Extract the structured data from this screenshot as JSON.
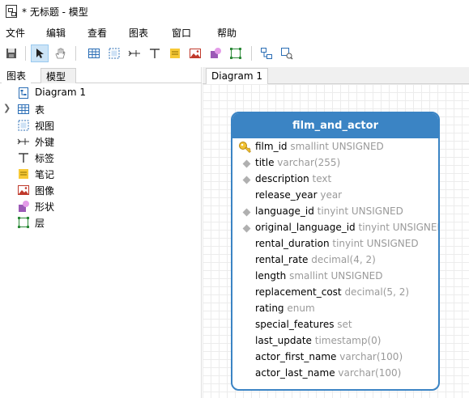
{
  "window": {
    "title": "* 无标题 - 模型"
  },
  "menu": [
    "文件",
    "编辑",
    "查看",
    "图表",
    "窗口",
    "帮助"
  ],
  "toolbar": {
    "tools": [
      "save-icon",
      "pointer-icon",
      "hand-icon",
      "table-icon",
      "view-icon",
      "foreign-key-icon",
      "label-icon",
      "note-icon",
      "image-icon",
      "shape-icon",
      "layer-icon",
      "auto-layout-icon",
      "zoom-fit-icon"
    ],
    "active_tool": "pointer-icon"
  },
  "left_panel": {
    "tabs": [
      "图表",
      "模型"
    ],
    "tree": [
      {
        "label": "Diagram 1",
        "icon": "diagram-icon"
      },
      {
        "label": "表",
        "icon": "table-icon",
        "expandable": true
      },
      {
        "label": "视图",
        "icon": "view-icon"
      },
      {
        "label": "外键",
        "icon": "foreign-key-icon"
      },
      {
        "label": "标签",
        "icon": "label-icon"
      },
      {
        "label": "笔记",
        "icon": "note-icon"
      },
      {
        "label": "图像",
        "icon": "image-icon"
      },
      {
        "label": "形状",
        "icon": "shape-icon"
      },
      {
        "label": "层",
        "icon": "layer-icon"
      }
    ]
  },
  "diagram": {
    "tab": "Diagram 1",
    "table": {
      "name": "film_and_actor",
      "fields": [
        {
          "name": "film_id",
          "type": "smallint UNSIGNED",
          "marker": "key"
        },
        {
          "name": "title",
          "type": "varchar(255)",
          "marker": "diamond"
        },
        {
          "name": "description",
          "type": "text",
          "marker": "diamond"
        },
        {
          "name": "release_year",
          "type": "year",
          "marker": ""
        },
        {
          "name": "language_id",
          "type": "tinyint UNSIGNED",
          "marker": "diamond"
        },
        {
          "name": "original_language_id",
          "type": "tinyint UNSIGNED",
          "marker": "diamond"
        },
        {
          "name": "rental_duration",
          "type": "tinyint UNSIGNED",
          "marker": ""
        },
        {
          "name": "rental_rate",
          "type": "decimal(4, 2)",
          "marker": ""
        },
        {
          "name": "length",
          "type": "smallint UNSIGNED",
          "marker": ""
        },
        {
          "name": "replacement_cost",
          "type": "decimal(5, 2)",
          "marker": ""
        },
        {
          "name": "rating",
          "type": "enum",
          "marker": ""
        },
        {
          "name": "special_features",
          "type": "set",
          "marker": ""
        },
        {
          "name": "last_update",
          "type": "timestamp(0)",
          "marker": ""
        },
        {
          "name": "actor_first_name",
          "type": "varchar(100)",
          "marker": ""
        },
        {
          "name": "actor_last_name",
          "type": "varchar(100)",
          "marker": ""
        }
      ]
    }
  },
  "colors": {
    "accent": "#3b84c4",
    "type_text": "#9a9a9a"
  }
}
